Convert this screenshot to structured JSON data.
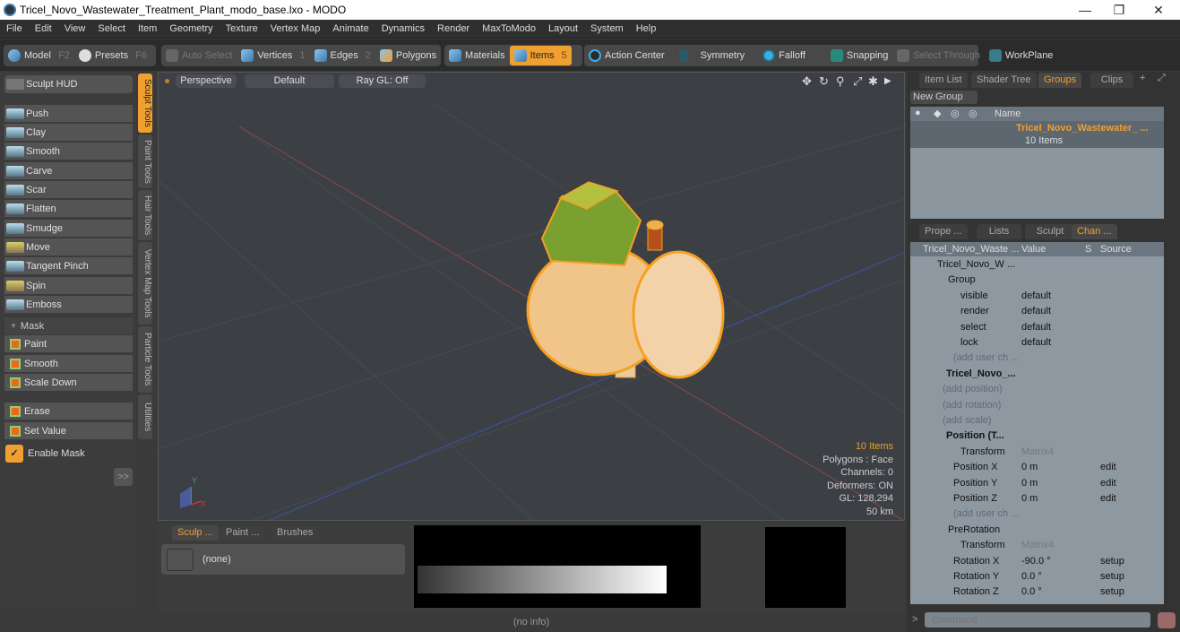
{
  "window": {
    "title": "Tricel_Novo_Wastewater_Treatment_Plant_modo_base.lxo - MODO",
    "minimize": "—",
    "restore": "❐",
    "close": "✕"
  },
  "menu": [
    "File",
    "Edit",
    "View",
    "Select",
    "Item",
    "Geometry",
    "Texture",
    "Vertex Map",
    "Animate",
    "Dynamics",
    "Render",
    "MaxToModo",
    "Layout",
    "System",
    "Help"
  ],
  "toolbar": {
    "model": {
      "label": "Model",
      "key": "F2"
    },
    "presets": {
      "label": "Presets",
      "key": "F6"
    },
    "auto_select": "Auto Select",
    "vertices": {
      "label": "Vertices",
      "key": "1"
    },
    "edges": {
      "label": "Edges",
      "key": "2"
    },
    "polygons": "Polygons",
    "materials": "Materials",
    "items": {
      "label": "Items",
      "key": "5"
    },
    "action_center": "Action Center",
    "symmetry": "Symmetry",
    "falloff": "Falloff",
    "snapping": "Snapping",
    "select_through": "Select Through",
    "workplane": "WorkPlane"
  },
  "left": {
    "sculpt_hud": "Sculpt HUD",
    "tools": [
      "Push",
      "Clay",
      "Smooth",
      "Carve",
      "Scar",
      "Flatten",
      "Smudge",
      "Move",
      "Tangent Pinch",
      "Spin",
      "Emboss"
    ],
    "mask_header": "Mask",
    "mask_tools": [
      "Paint",
      "Smooth",
      "Scale Down"
    ],
    "mask_tools2": [
      "Erase",
      "Set Value"
    ],
    "enable_mask": "Enable Mask",
    "more": ">>",
    "vtabs": [
      "Sculpt Tools",
      "Paint Tools",
      "Hair Tools",
      "Vertex Map Tools",
      "Particle Tools",
      "Utilities"
    ]
  },
  "viewport": {
    "view": "Perspective",
    "shading": "Default",
    "raygl": "Ray GL: Off",
    "hud": {
      "items": "10 Items",
      "polygons": "Polygons : Face",
      "channels": "Channels: 0",
      "deformers": "Deformers: ON",
      "gl": "GL: 128,294",
      "scale": "50 km"
    },
    "axes": {
      "y": "Y",
      "x": "X"
    }
  },
  "groups_panel": {
    "tabs": [
      "Item List",
      "Shader Tree",
      "Groups",
      "Clips"
    ],
    "new_group": "New Group",
    "col_name": "Name",
    "group_name": "Tricel_Novo_Wastewater_ ...",
    "group_count": "10 Items"
  },
  "channels_panel": {
    "tabs": [
      "Prope ...",
      "Lists",
      "Sculpt",
      "Chan ..."
    ],
    "headers": [
      "Tricel_Novo_Waste ...",
      "Value",
      "S",
      "Source"
    ],
    "rows": [
      {
        "name": "Tricel_Novo_W ...",
        "value": "",
        "source": ""
      },
      {
        "name": "Group",
        "value": "",
        "source": ""
      },
      {
        "name": "visible",
        "value": "default",
        "source": ""
      },
      {
        "name": "render",
        "value": "default",
        "source": ""
      },
      {
        "name": "select",
        "value": "default",
        "source": ""
      },
      {
        "name": "lock",
        "value": "default",
        "source": ""
      },
      {
        "name": "(add user ch ...",
        "value": "",
        "source": ""
      },
      {
        "name": "Tricel_Novo_...",
        "value": "",
        "source": ""
      },
      {
        "name": "(add position)",
        "value": "",
        "source": ""
      },
      {
        "name": "(add rotation)",
        "value": "",
        "source": ""
      },
      {
        "name": "(add scale)",
        "value": "",
        "source": ""
      },
      {
        "name": "Position (T...",
        "value": "",
        "source": ""
      },
      {
        "name": "Transform",
        "value": "Matrix4",
        "source": ""
      },
      {
        "name": "Position X",
        "value": "0 m",
        "source": "edit"
      },
      {
        "name": "Position Y",
        "value": "0 m",
        "source": "edit"
      },
      {
        "name": "Position Z",
        "value": "0 m",
        "source": "edit"
      },
      {
        "name": "(add user ch ...",
        "value": "",
        "source": ""
      },
      {
        "name": "PreRotation",
        "value": "",
        "source": ""
      },
      {
        "name": "Transform",
        "value": "Matrix4",
        "source": ""
      },
      {
        "name": "Rotation X",
        "value": "-90.0 °",
        "source": "setup"
      },
      {
        "name": "Rotation Y",
        "value": "0.0 °",
        "source": "setup"
      },
      {
        "name": "Rotation Z",
        "value": "0.0 °",
        "source": "setup"
      }
    ]
  },
  "bottom": {
    "tabs": [
      "Sculp ...",
      "Paint ...",
      "Brushes"
    ],
    "brush": "(none)"
  },
  "status": "(no info)",
  "command": {
    "placeholder": "Command"
  }
}
